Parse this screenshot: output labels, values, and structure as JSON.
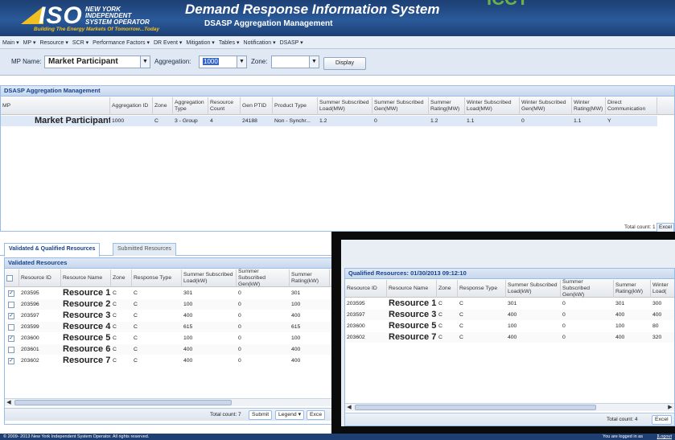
{
  "header": {
    "logo_text": "ISO",
    "logo_line1": "NEW YORK",
    "logo_line2": "INDEPENDENT",
    "logo_line3": "SYSTEM OPERATOR",
    "logo_tagline": "Building The Energy Markets Of Tomorrow...Today",
    "title": "Demand Response Information System",
    "subtitle": "DSASP Aggregation Management",
    "brand_color": "#1d3f73",
    "accent_color": "#f0c020",
    "partner_logo_text": "ICCT"
  },
  "menu": [
    {
      "label": "Main ▾"
    },
    {
      "label": "MP ▾"
    },
    {
      "label": "Resource ▾"
    },
    {
      "label": "SCR ▾"
    },
    {
      "label": "Performance Factors ▾"
    },
    {
      "label": "DR Event ▾"
    },
    {
      "label": "Mitigation ▾"
    },
    {
      "label": "Tables ▾"
    },
    {
      "label": "Notification ▾"
    },
    {
      "label": "DSASP ▾"
    }
  ],
  "filters": {
    "mp_label": "MP Name:",
    "mp_value": "Market Participant",
    "aggregation_label": "Aggregation:",
    "aggregation_value": "1000",
    "zone_label": "Zone:",
    "zone_value": "",
    "display_button": "Display"
  },
  "aggregation_panel": {
    "title": "DSASP Aggregation Management",
    "columns": [
      "MP",
      "Aggregation ID",
      "Zone",
      "Aggregation Type",
      "Resource Count",
      "Gen PTID",
      "Product Type",
      "Summer Subscribed Load(MW)",
      "Summer Subscribed Gen(MW)",
      "Summer Rating(MW)",
      "Winter Subscribed Load(MW)",
      "Winter Subscribed Gen(MW)",
      "Winter Rating(MW)",
      "Direct Communication"
    ],
    "row": [
      "Market Participant",
      "1000",
      "C",
      "3 - Group",
      "4",
      "24188",
      "Non - Synchr...",
      "1.2",
      "0",
      "1.2",
      "1.1",
      "0",
      "1.1",
      "Y"
    ],
    "total_count": "Total count: 1",
    "excel_label": "Excel"
  },
  "tabs": [
    {
      "label": "Validated & Qualified Resources"
    },
    {
      "label": "Submitted Resources"
    }
  ],
  "validated": {
    "title": "Validated Resources",
    "columns": [
      "Resource ID",
      "Resource Name",
      "Zone",
      "Response Type",
      "Summer Subscribed Load(kW)",
      "Summer Subscribed Gen(kW)",
      "Summer Rating(kW)"
    ],
    "rows": [
      {
        "checked": "✓",
        "id": "203595",
        "name": "Resource 1",
        "zone": "C",
        "type": "C",
        "load": "301",
        "gen": "0",
        "rating": "301"
      },
      {
        "checked": "",
        "id": "203596",
        "name": "Resource 2",
        "zone": "C",
        "type": "C",
        "load": "100",
        "gen": "0",
        "rating": "100"
      },
      {
        "checked": "✓",
        "id": "203597",
        "name": "Resource 3",
        "zone": "C",
        "type": "C",
        "load": "400",
        "gen": "0",
        "rating": "400"
      },
      {
        "checked": "",
        "id": "203599",
        "name": "Resource 4",
        "zone": "C",
        "type": "C",
        "load": "615",
        "gen": "0",
        "rating": "615"
      },
      {
        "checked": "✓",
        "id": "203600",
        "name": "Resource 5",
        "zone": "C",
        "type": "C",
        "load": "100",
        "gen": "0",
        "rating": "100"
      },
      {
        "checked": "",
        "id": "203601",
        "name": "Resource 6",
        "zone": "C",
        "type": "C",
        "load": "400",
        "gen": "0",
        "rating": "400"
      },
      {
        "checked": "✓",
        "id": "203602",
        "name": "Resource 7",
        "zone": "C",
        "type": "C",
        "load": "400",
        "gen": "0",
        "rating": "400"
      }
    ],
    "total_count": "Total count: 7",
    "submit_label": "Submit",
    "legend_label": "Legend ▾",
    "excel_label": "Exce"
  },
  "qualified": {
    "title": "Qualified Resources: 01/30/2013 09:12:10",
    "columns": [
      "Resource ID",
      "Resource Name",
      "Zone",
      "Response Type",
      "Summer Subscribed Load(kW)",
      "Summer Subscribed Gen(kW)",
      "Summer Rating(kW)",
      "Winter Load("
    ],
    "rows": [
      {
        "id": "203595",
        "name": "Resource 1",
        "zone": "C",
        "type": "C",
        "load": "301",
        "gen": "0",
        "rating": "301",
        "winter": "300"
      },
      {
        "id": "203597",
        "name": "Resource 3",
        "zone": "C",
        "type": "C",
        "load": "400",
        "gen": "0",
        "rating": "400",
        "winter": "400"
      },
      {
        "id": "203600",
        "name": "Resource 5",
        "zone": "C",
        "type": "C",
        "load": "100",
        "gen": "0",
        "rating": "100",
        "winter": "80"
      },
      {
        "id": "203602",
        "name": "Resource 7",
        "zone": "C",
        "type": "C",
        "load": "400",
        "gen": "0",
        "rating": "400",
        "winter": "320"
      }
    ],
    "total_count": "Total count: 4",
    "excel_label": "Excel"
  },
  "status": {
    "copyright": "© 2009- 2013 New York Independent System Operator. All rights reserved.",
    "logged_in": "You are logged in as",
    "logout": "[Logout"
  }
}
